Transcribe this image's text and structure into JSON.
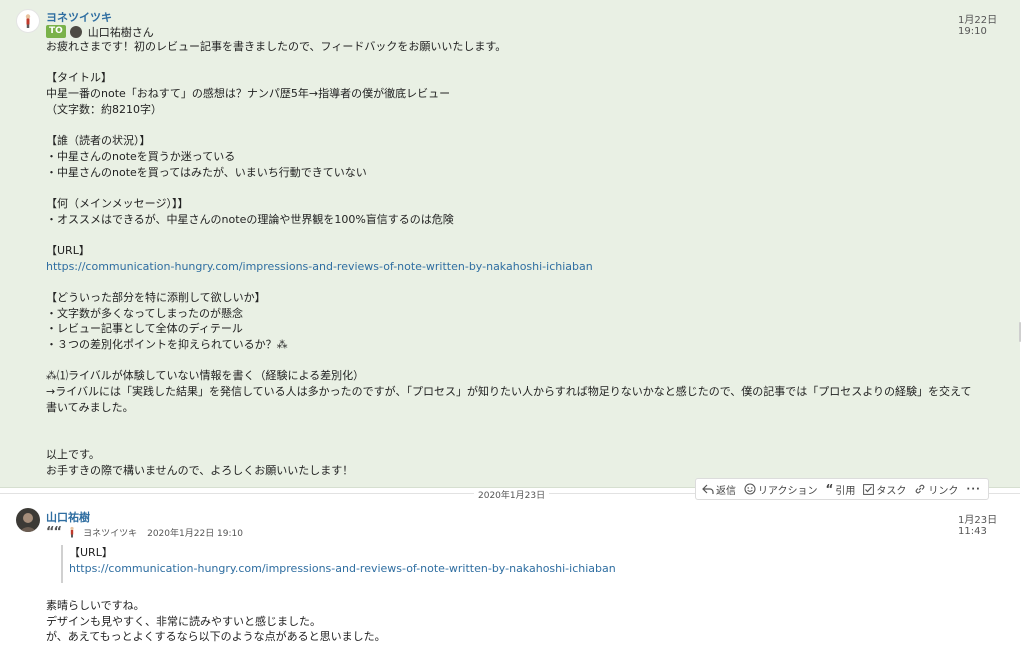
{
  "message1": {
    "sender": "ヨネツイツキ",
    "timestamp": "1月22日 19:10",
    "to_badge": "TO",
    "to_name": "山口祐樹さん",
    "lines": [
      "お疲れさまです！初のレビュー記事を書きましたので、フィードバックをお願いいたします。",
      "",
      "【タイトル】",
      "中星一番のnote「おねすて」の感想は？ナンパ歴5年→指導者の僕が徹底レビュー",
      "（文字数：約8210字）",
      "",
      "【誰（読者の状況）】",
      "・中星さんのnoteを買うか迷っている",
      "・中星さんのnoteを買ってはみたが、いまいち行動できていない",
      "",
      "【何（メインメッセージ）】】",
      "・オススメはできるが、中星さんのnoteの理論や世界観を100%盲信するのは危険",
      "",
      "【URL】",
      "https://communication-hungry.com/impressions-and-reviews-of-note-written-by-nakahoshi-ichiaban",
      "",
      "【どういった部分を特に添削して欲しいか】",
      "・文字数が多くなってしまったのが懸念",
      "・レビュー記事として全体のディテール",
      "・３つの差別化ポイントを抑えられているか？⁂",
      "",
      "⁂⑴ライバルが体験していない情報を書く（経験による差別化）",
      "→ライバルには「実践した結果」を発信している人は多かったのですが、「プロセス」が知りたい人からすれば物足りないかなと感じたので、僕の記事では「プロセスよりの経験」を交えて",
      "書いてみました。",
      "",
      "",
      "以上です。",
      "お手すきの際で構いませんので、よろしくお願いいたします！"
    ]
  },
  "actions": {
    "reply": "返信",
    "reaction": "リアクション",
    "quote": "引用",
    "task": "タスク",
    "link": "リンク",
    "more": "···"
  },
  "date_divider": "2020年1月23日",
  "message2": {
    "sender": "山口祐樹",
    "timestamp": "1月23日 11:43",
    "quote_author": "ヨネツイツキ",
    "quote_time": "2020年1月22日 19:10",
    "quote_label": "【URL】",
    "quote_link": "https://communication-hungry.com/impressions-and-reviews-of-note-written-by-nakahoshi-ichiaban",
    "lines": [
      "素晴らしいですね。",
      "デザインも見やすく、非常に読みやすいと感じました。",
      "が、あえてもっとよくするなら以下のような点があると思いました。"
    ]
  }
}
